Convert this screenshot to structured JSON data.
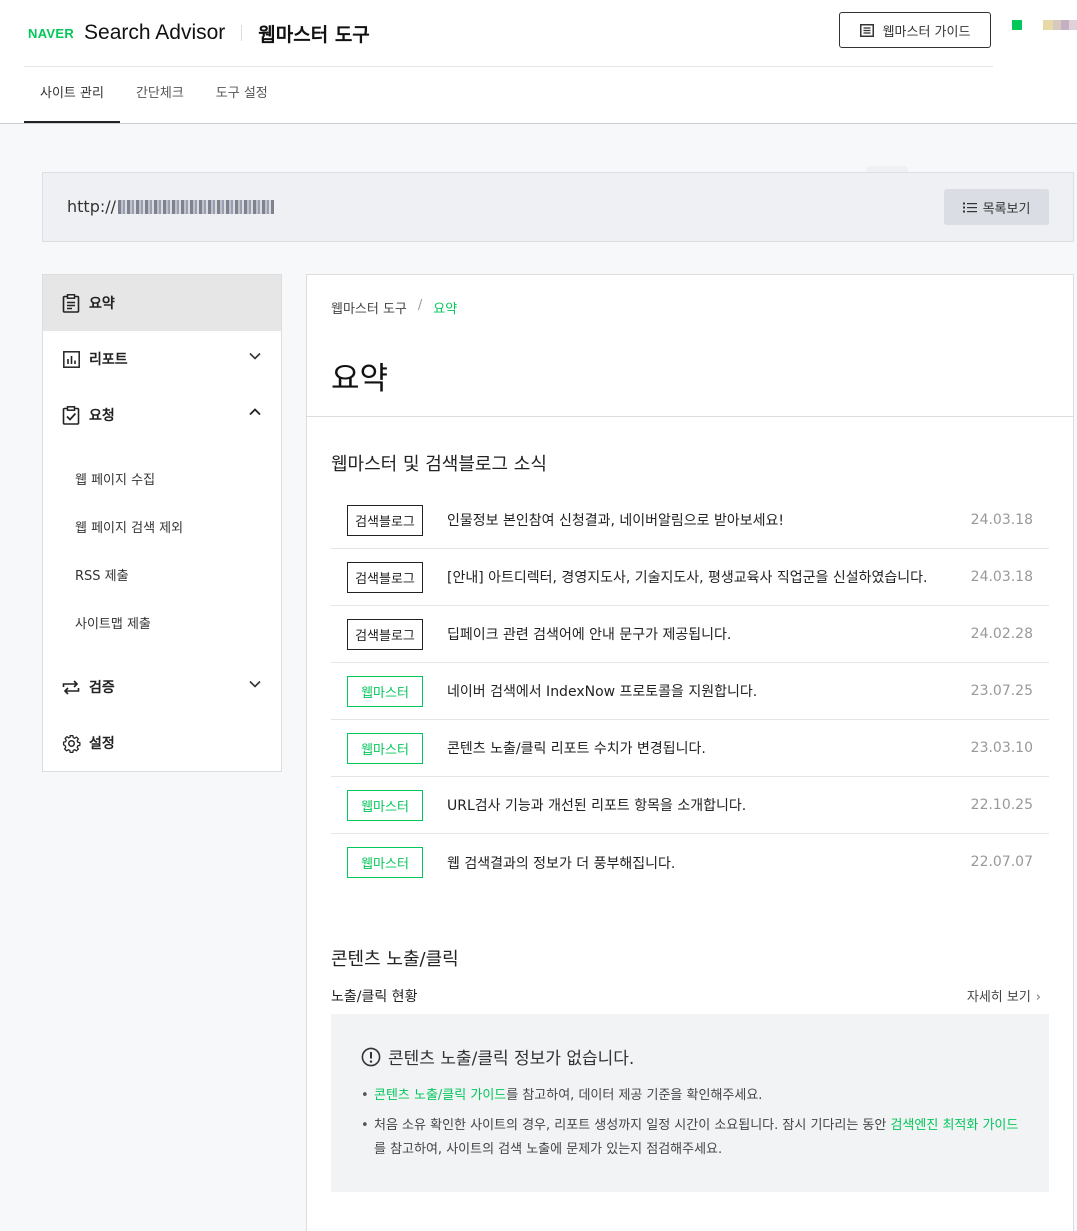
{
  "header": {
    "naver_logo": "NAVER",
    "brand_name": "Search Advisor",
    "tool_title": "웹마스터 도구",
    "guide_button": "웹마스터 가이드",
    "tabs": [
      "사이트 관리",
      "간단체크",
      "도구 설정"
    ],
    "active_tab": "사이트 관리"
  },
  "site": {
    "url_prefix": "http://",
    "list_button": "목록보기"
  },
  "sidebar": {
    "items": [
      {
        "label": "요약",
        "icon": "clipboard-icon",
        "active": true
      },
      {
        "label": "리포트",
        "icon": "bar-chart-icon",
        "expanded": false
      },
      {
        "label": "요청",
        "icon": "check-clipboard-icon",
        "expanded": true
      },
      {
        "label": "검증",
        "icon": "sync-icon",
        "expanded": false
      },
      {
        "label": "설정",
        "icon": "gear-icon"
      }
    ],
    "request_submenu": [
      "웹 페이지 수집",
      "웹 페이지 검색 제외",
      "RSS 제출",
      "사이트맵 제출"
    ]
  },
  "main": {
    "breadcrumb": [
      "웹마스터 도구",
      "요약"
    ],
    "page_title": "요약",
    "news_title": "웹마스터 및 검색블로그 소식",
    "news": [
      {
        "tag": "검색블로그",
        "text": "인물정보 본인참여 신청결과, 네이버알림으로 받아보세요!",
        "date": "24.03.18"
      },
      {
        "tag": "검색블로그",
        "text": "[안내] 아트디렉터, 경영지도사, 기술지도사, 평생교육사 직업군을 신설하였습니다.",
        "date": "24.03.18"
      },
      {
        "tag": "검색블로그",
        "text": "딥페이크 관련 검색어에 안내 문구가 제공됩니다.",
        "date": "24.02.28"
      },
      {
        "tag": "웹마스터",
        "text": "네이버 검색에서 IndexNow 프로토콜을 지원합니다.",
        "date": "23.07.25"
      },
      {
        "tag": "웹마스터",
        "text": "콘텐츠 노출/클릭 리포트 수치가 변경됩니다.",
        "date": "23.03.10"
      },
      {
        "tag": "웹마스터",
        "text": "URL검사 기능과 개선된 리포트 항목을 소개합니다.",
        "date": "22.10.25"
      },
      {
        "tag": "웹마스터",
        "text": "웹 검색결과의 정보가 더 풍부해집니다.",
        "date": "22.07.07"
      }
    ],
    "exposure_title": "콘텐츠 노출/클릭",
    "exposure_subtitle": "노출/클릭 현황",
    "more_link": "자세히 보기",
    "empty_message": "콘텐츠 노출/클릭 정보가 없습니다.",
    "note1_link": "콘텐츠 노출/클릭 가이드",
    "note1_text": "를 참고하여, 데이터 제공 기준을 확인해주세요.",
    "note2_text": "처음 소유 확인한 사이트의 경우, 리포트 생성까지 일정 시간이 소요됩니다. 잠시 기다리는 동안 ",
    "note2_link": "검색엔진 최적화 가이드",
    "note2_text_after": "를 참고하여, 사이트의 검색 노출에 문제가 있는지 점검해주세요."
  },
  "colors": {
    "accent": "#03c75a",
    "text": "#222222",
    "muted": "#999999"
  }
}
